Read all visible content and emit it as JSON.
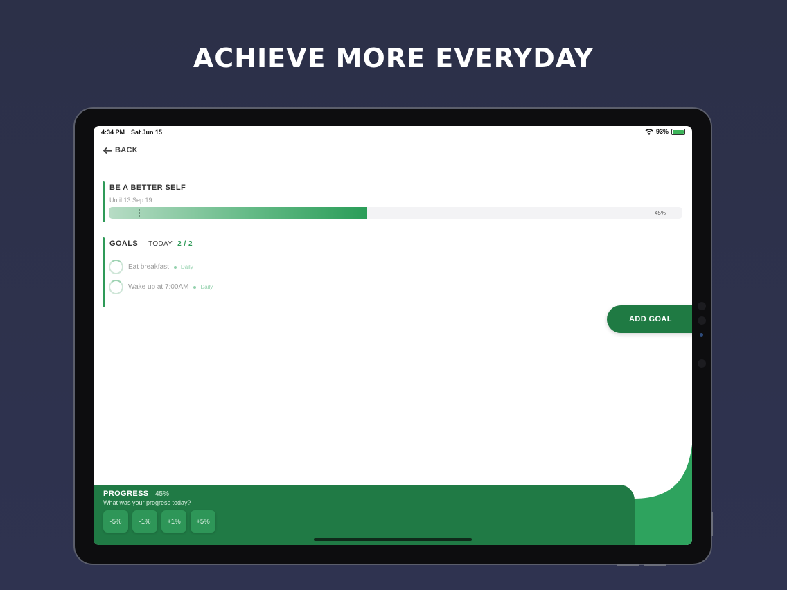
{
  "headline": "ACHIEVE MORE EVERYDAY",
  "status_bar": {
    "time": "4:34 PM",
    "date": "Sat Jun 15",
    "battery_percent": "93%",
    "icons": [
      "wifi-icon",
      "battery-icon"
    ]
  },
  "nav": {
    "back_label": "BACK",
    "back_icon": "arrow-left-icon"
  },
  "goal": {
    "title": "BE A BETTER SELF",
    "until": "Until 13 Sep 19",
    "progress_label": "45%",
    "progress_fraction": 0.45
  },
  "goals_section": {
    "label": "GOALS",
    "today_label": "TODAY",
    "count": "2 / 2",
    "items": [
      {
        "name": "Eat breakfast",
        "frequency": "Daily",
        "completed": true
      },
      {
        "name": "Wake up at 7:00AM",
        "frequency": "Daily",
        "completed": true
      }
    ]
  },
  "add_goal_label": "ADD GOAL",
  "progress_panel": {
    "title": "PROGRESS",
    "percent": "45%",
    "question": "What was your progress today?",
    "buttons": [
      "-5%",
      "-1%",
      "+1%",
      "+5%"
    ]
  },
  "colors": {
    "accent_green": "#2f9a58",
    "dark_green": "#1f7a43",
    "background": "#2c3048"
  }
}
